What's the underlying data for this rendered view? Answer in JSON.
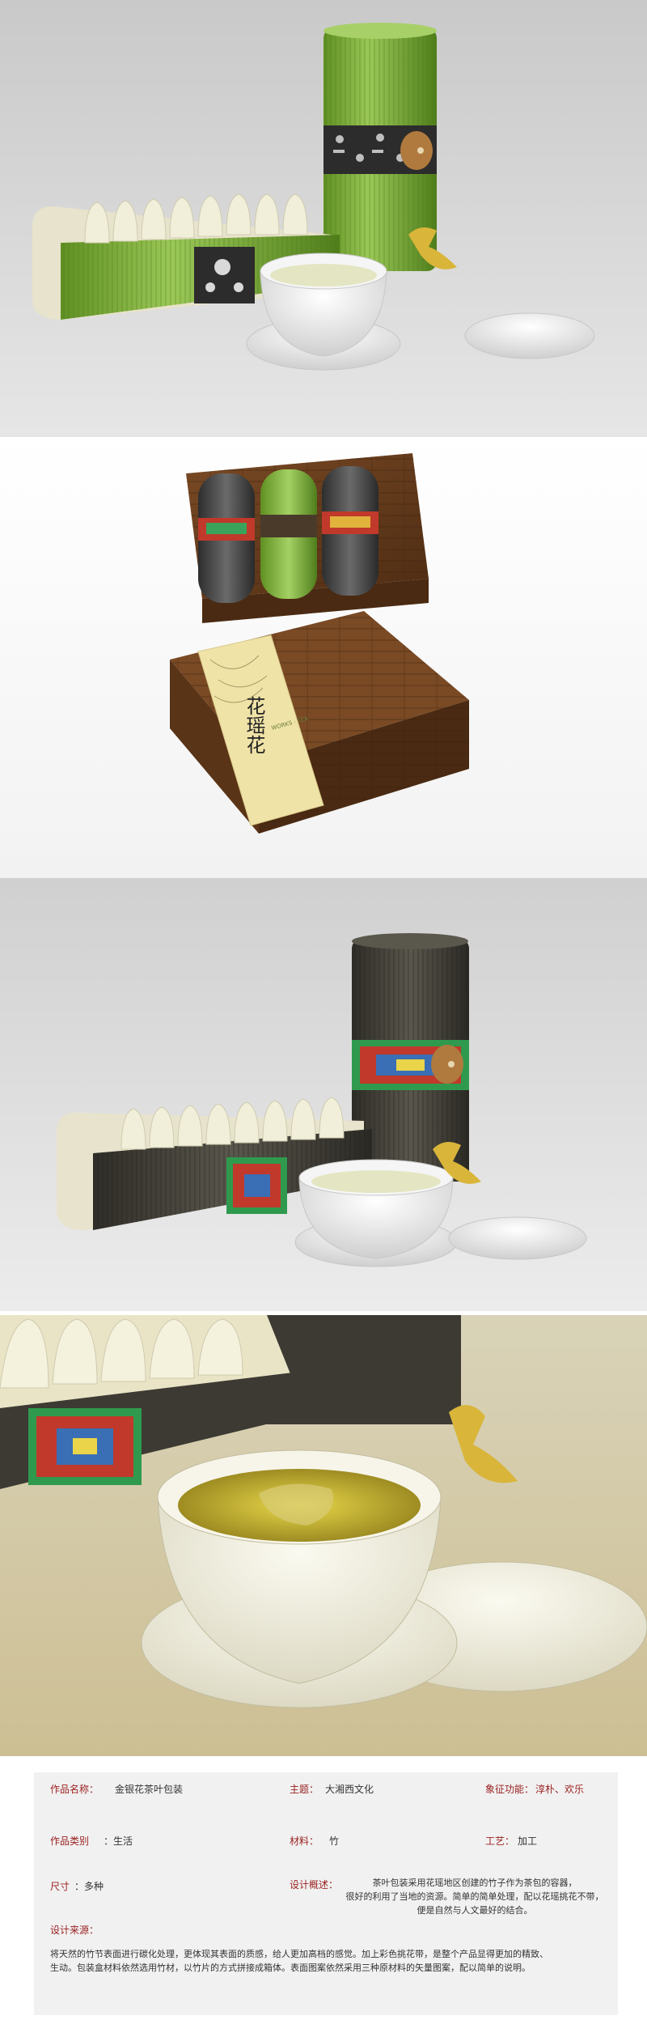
{
  "product": {
    "title_vertical": "花瑶花",
    "box_small_text": "WORKS · TEA"
  },
  "info": {
    "name_label": "作品名称：",
    "name_value": "金银花茶叶包装",
    "theme_label": "主题：",
    "theme_value": "大湘西文化",
    "symbol_label": "象征功能：",
    "symbol_value": "淳朴、欢乐",
    "category_label": "作品类别",
    "category_value": "：生活",
    "material_label": "材料：",
    "material_value": "竹",
    "craft_label": "工艺：",
    "craft_value": "加工",
    "size_label": "尺寸",
    "size_value": "：多种",
    "overview_label": "设计概述：",
    "overview_lines": [
      "茶叶包装采用花瑶地区创建的竹子作为茶包的容器，",
      "很好的利用了当地的资源。简单的简单处理，配以花瑶挑花不带，",
      "便是自然与人文最好的结合。"
    ],
    "source_label": "设计来源：",
    "source_lines": [
      "将天然的竹节表面进行碳化处理，更体现其表面的质感，给人更加高档的感觉。加上彩色挑花带，是整个产品显得更加的精致、",
      "生动。包装盒材料依然选用竹材，以竹片的方式拼接成箱体。表面图案依然采用三种原材料的矢量图案，配以简单的说明。"
    ]
  },
  "colors": {
    "label_red": "#9a1f1f",
    "bamboo_green": "#7fae3a",
    "bamboo_dark": "#3d3a33",
    "box_brown": "#6b3f1f",
    "sleeve_cream": "#efe3a8"
  }
}
